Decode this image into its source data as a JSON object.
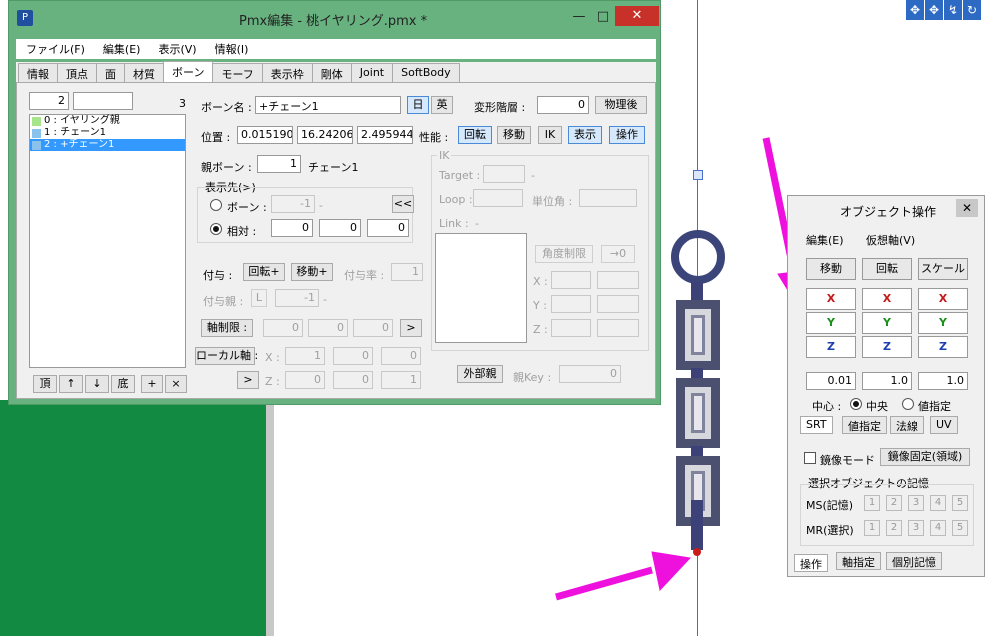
{
  "background": {
    "viewport_axis_color": "#2a9a2a",
    "desktop_color": "#128a42"
  },
  "viewport_toolbar": {
    "icons": [
      "move-icon",
      "move-all-icon",
      "rotate-axis-icon",
      "refresh-icon"
    ],
    "glyphs": [
      "✥",
      "✥",
      "↯",
      "↻"
    ]
  },
  "window": {
    "title": "Pmx編集 - 桃イヤリング.pmx *",
    "minimize": "—",
    "maximize": "□",
    "close": "✕",
    "menu": [
      "ファイル(F)",
      "編集(E)",
      "表示(V)",
      "情報(I)"
    ],
    "tabs": [
      "情報",
      "頂点",
      "面",
      "材質",
      "ボーン",
      "モーフ",
      "表示枠",
      "剛体",
      "Joint",
      "SoftBody"
    ],
    "active_tab": "ボーン"
  },
  "bone_panel": {
    "index_value": "2",
    "name_filter": "",
    "count": "3",
    "bones": [
      {
        "label": "0 : イヤリング親",
        "color": "#a6e58a"
      },
      {
        "label": "1 : チェーン1",
        "color": "#8ac2ee"
      },
      {
        "label": "2 : +チェーン1",
        "color": "#8ac2ee"
      }
    ],
    "selected_index": 2,
    "list_buttons": [
      "頂",
      "↑",
      "↓",
      "底",
      "+",
      "×"
    ]
  },
  "bone_editor": {
    "name_label": "ボーン名 :",
    "name_value": "+チェーン1",
    "lang_jp": "日",
    "lang_en": "英",
    "deform_layer_label": "変形階層 :",
    "deform_layer_value": "0",
    "physics_after": "物理後",
    "position_label": "位置 :",
    "position": [
      "0.0151901",
      "16.24206",
      "2.495944E"
    ],
    "perf_label": "性能 :",
    "perf_buttons": [
      "回転",
      "移動",
      "IK",
      "表示",
      "操作"
    ],
    "parent_label": "親ボーン :",
    "parent_value": "1",
    "parent_name": "チェーン1",
    "display_to_label": "表示先(>)",
    "radio_bone": "ボーン :",
    "radio_bone_value": "-1",
    "radio_bone_dash": "-",
    "radio_bone_btn": "<<",
    "radio_relative": "相対 :",
    "relative": [
      "0",
      "0",
      "0"
    ],
    "grant_label": "付与 :",
    "grant_rot": "回転+",
    "grant_move": "移動+",
    "grant_rate_label": "付与率 :",
    "grant_rate": "1",
    "grant_parent_label": "付与親 :",
    "grant_parent_btn": "L",
    "grant_parent_value": "-1",
    "grant_parent_dash": "-",
    "axis_limit": "軸制限 :",
    "axis_limit_values": [
      "0",
      "0",
      "0"
    ],
    "axis_limit_btn": ">",
    "local_axis": "ローカル軸 :",
    "local_x_label": "X :",
    "local_x": [
      "1",
      "0",
      "0"
    ],
    "local_z_btn": ">",
    "local_z_label": "Z :",
    "local_z": [
      "0",
      "0",
      "1"
    ],
    "ik_label": "IK",
    "ik_target": "Target :",
    "ik_target_dash": "-",
    "ik_loop": "Loop :",
    "ik_unit_angle": "単位角 :",
    "ik_link": "Link :",
    "ik_link_dash": "-",
    "ik_angle_limit": "角度制限",
    "ik_to_zero": "→0",
    "ik_x": "X :",
    "ik_y": "Y :",
    "ik_z": "Z :",
    "external_parent": "外部親",
    "parent_key_label": "親Key :",
    "parent_key": "0"
  },
  "object_panel": {
    "title": "オブジェクト操作",
    "close": "✕",
    "menu": [
      "編集(E)",
      "仮想軸(V)"
    ],
    "modes": [
      "移動",
      "回転",
      "スケール"
    ],
    "axes": [
      "X",
      "Y",
      "Z"
    ],
    "steps": [
      "0.01",
      "1.0",
      "1.0"
    ],
    "center_label": "中心 :",
    "center_option_1": "中央",
    "center_option_2": "値指定",
    "center_selected": "中央",
    "subtabs": [
      "SRT",
      "値指定",
      "法線",
      "UV"
    ],
    "mirror_mode": "鏡像モード",
    "mirror_fixed": "鏡像固定(領域)",
    "memory_label": "選択オブジェクトの記憶",
    "ms_label": "MS(記憶)",
    "mr_label": "MR(選択)",
    "slots": [
      "1",
      "2",
      "3",
      "4",
      "5"
    ],
    "bottom_tabs": [
      "操作",
      "軸指定",
      "個別記憶"
    ]
  },
  "annotation_color": "#ee11dd"
}
